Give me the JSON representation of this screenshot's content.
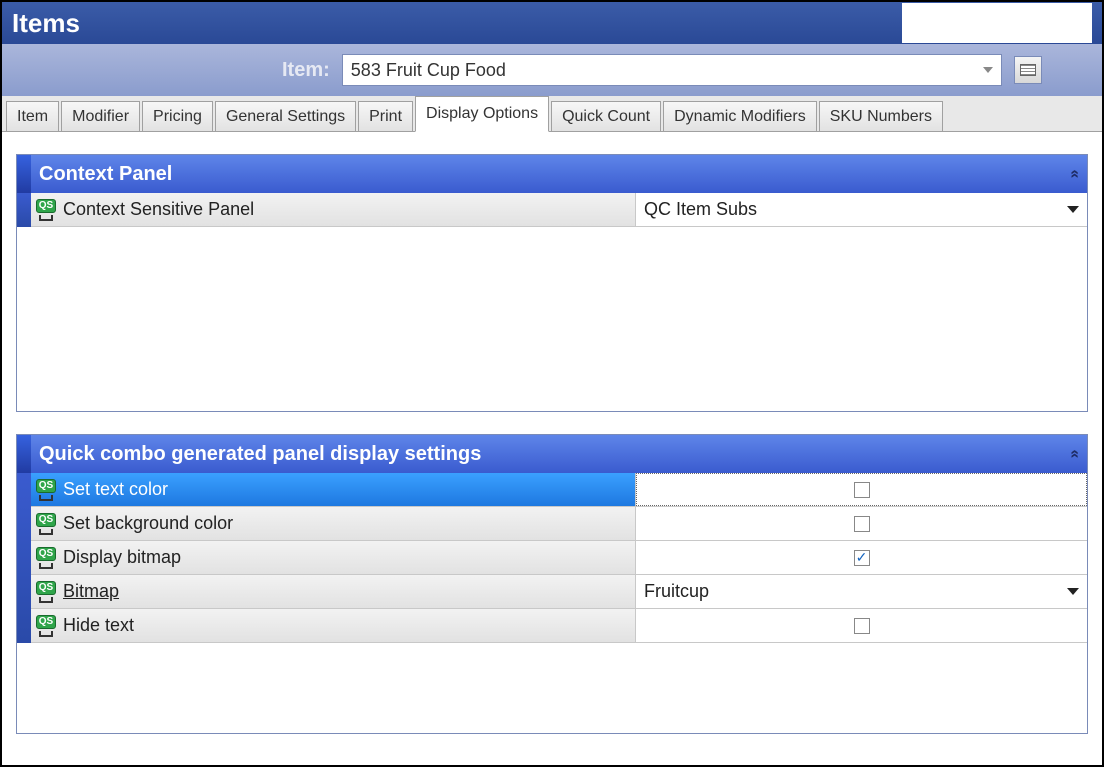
{
  "titlebar": {
    "title": "Items"
  },
  "itembar": {
    "label": "Item:",
    "value": "583 Fruit Cup Food"
  },
  "tabs": [
    {
      "label": "Item"
    },
    {
      "label": "Modifier"
    },
    {
      "label": "Pricing"
    },
    {
      "label": "General Settings"
    },
    {
      "label": "Print"
    },
    {
      "label": "Display Options",
      "active": true
    },
    {
      "label": "Quick Count"
    },
    {
      "label": "Dynamic Modifiers"
    },
    {
      "label": "SKU Numbers"
    }
  ],
  "contextPanel": {
    "title": "Context Panel",
    "row": {
      "label": "Context Sensitive Panel",
      "value": "QC Item Subs"
    }
  },
  "quickComboPanel": {
    "title": "Quick combo generated panel display settings",
    "rows": [
      {
        "label": "Set text color",
        "type": "checkbox",
        "checked": false,
        "selected": true
      },
      {
        "label": "Set background color",
        "type": "checkbox",
        "checked": false
      },
      {
        "label": "Display bitmap",
        "type": "checkbox",
        "checked": true
      },
      {
        "label": "Bitmap",
        "type": "dropdown",
        "value": "Fruitcup",
        "link": true
      },
      {
        "label": "Hide text",
        "type": "checkbox",
        "checked": false
      }
    ]
  },
  "qs_badge": "QS"
}
